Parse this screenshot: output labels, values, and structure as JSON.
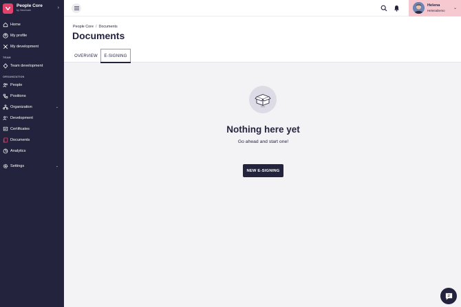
{
  "brand": {
    "name": "People Core",
    "sub": "by Newmark"
  },
  "sidebar": {
    "items_top": [
      {
        "label": "Home",
        "icon": "home-icon"
      },
      {
        "label": "My profile",
        "icon": "user-icon"
      },
      {
        "label": "My development",
        "icon": "development-icon"
      }
    ],
    "section_team": "TEAM",
    "items_team": [
      {
        "label": "Team development",
        "icon": "team-development-icon"
      }
    ],
    "section_org": "ORGANIZATION",
    "items_org": [
      {
        "label": "People",
        "icon": "people-icon"
      },
      {
        "label": "Positions",
        "icon": "positions-icon"
      },
      {
        "label": "Organization",
        "icon": "organization-icon",
        "chevron": true
      },
      {
        "label": "Development",
        "icon": "development-icon"
      },
      {
        "label": "Certificates",
        "icon": "certificate-icon"
      },
      {
        "label": "Documents",
        "icon": "documents-icon",
        "active": true
      },
      {
        "label": "Analytics",
        "icon": "analytics-icon"
      }
    ],
    "settings": {
      "label": "Settings",
      "icon": "gear-icon"
    }
  },
  "user": {
    "name": "Helena",
    "company": "HelenaDemo"
  },
  "breadcrumb": {
    "root": "People Core",
    "separator": "/",
    "current": "Documents"
  },
  "page": {
    "title": "Documents"
  },
  "tabs": [
    {
      "label": "OVERVIEW",
      "active": false
    },
    {
      "label": "E-SIGNING",
      "active": true
    }
  ],
  "empty": {
    "title": "Nothing here yet",
    "subtitle": "Go ahead and start one!",
    "cta": "NEW E-SIGNING"
  },
  "colors": {
    "sidebar": "#24233d",
    "accent": "#e0426b",
    "user_area": "#f5c9cf"
  }
}
